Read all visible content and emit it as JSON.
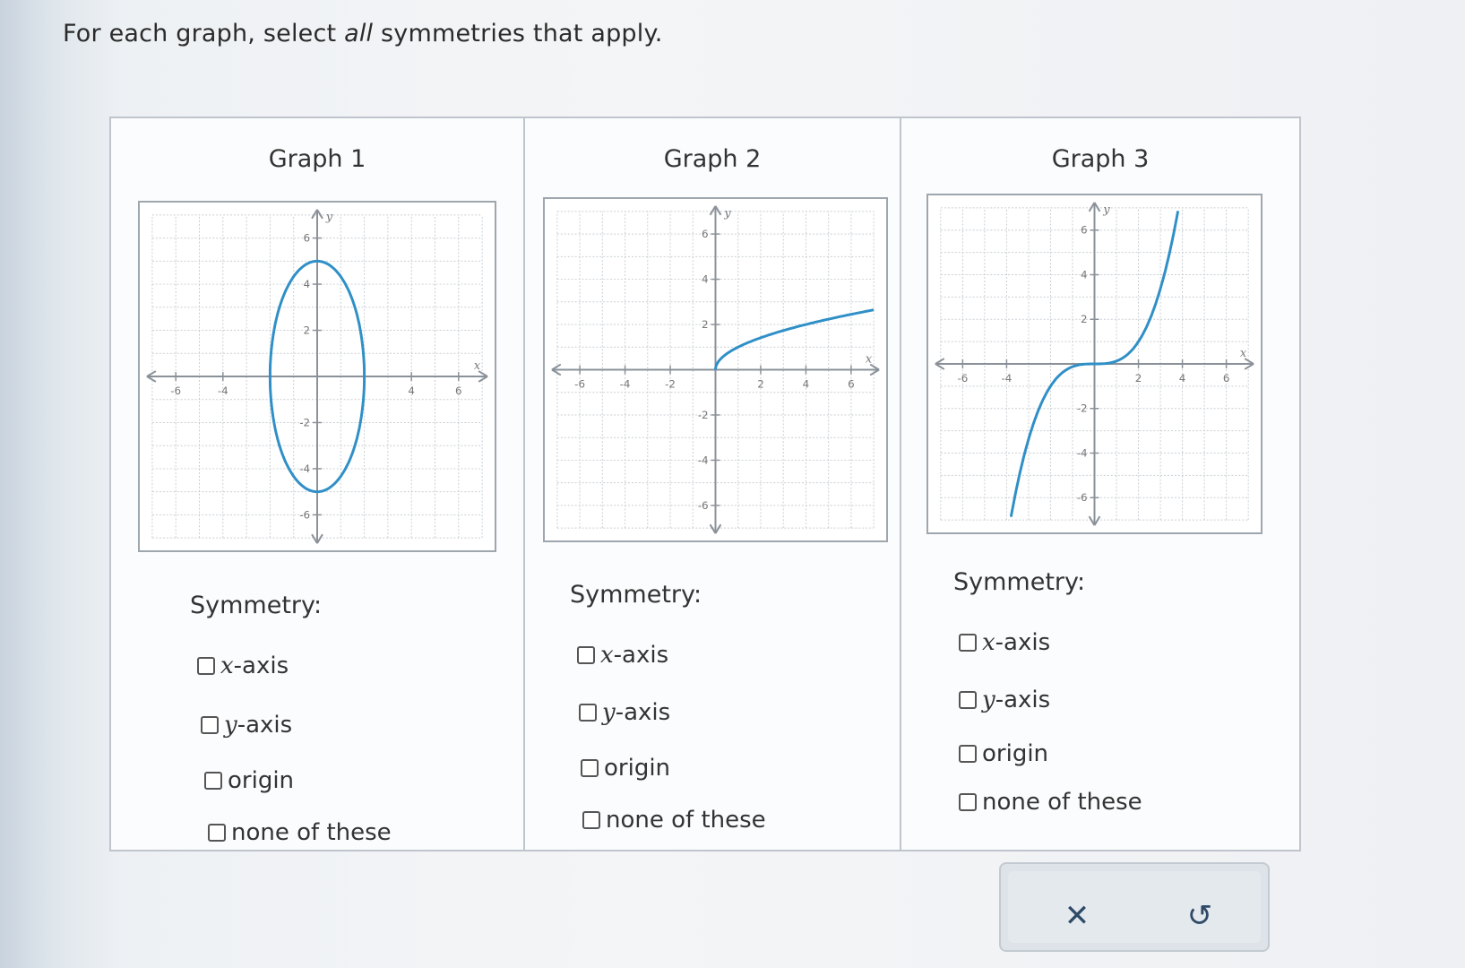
{
  "prompt": {
    "before": "For each graph, select ",
    "emphasis": "all",
    "after": " symmetries that apply."
  },
  "graphs": [
    {
      "title": "Graph 1",
      "chart_data": {
        "type": "line",
        "title": "Graph 1",
        "xlabel": "x",
        "ylabel": "y",
        "xlim": [
          -7,
          7
        ],
        "ylim": [
          -7,
          7
        ],
        "xticks": [
          -6,
          -4,
          4,
          6
        ],
        "yticks": [
          6,
          4,
          2,
          -2,
          -4,
          -6
        ],
        "grid": true,
        "curve": "ellipse centered at origin, x-radius 2, y-radius 5"
      }
    },
    {
      "title": "Graph 2",
      "chart_data": {
        "type": "line",
        "title": "Graph 2",
        "xlabel": "x",
        "ylabel": "y",
        "xlim": [
          -7,
          7
        ],
        "ylim": [
          -7,
          7
        ],
        "xticks": [
          -6,
          -4,
          -2,
          2,
          4,
          6
        ],
        "yticks": [
          6,
          4,
          2,
          -2,
          -4,
          -6
        ],
        "grid": true,
        "curve": "square-root curve from (0,0) rising to about (7,2.6)"
      }
    },
    {
      "title": "Graph 3",
      "chart_data": {
        "type": "line",
        "title": "Graph 3",
        "xlabel": "x",
        "ylabel": "y",
        "xlim": [
          -7,
          7
        ],
        "ylim": [
          -7,
          7
        ],
        "xticks": [
          -6,
          -4,
          2,
          4,
          6
        ],
        "yticks": [
          6,
          4,
          2,
          -2,
          -4,
          -6
        ],
        "grid": true,
        "curve": "cubic y = x^3/8 through origin"
      }
    }
  ],
  "symmetry_label": "Symmetry:",
  "options": {
    "x_axis_var": "x",
    "x_axis_suffix": "-axis",
    "y_axis_var": "y",
    "y_axis_suffix": "-axis",
    "origin": "origin",
    "none": "none of these"
  },
  "actions": {
    "clear_glyph": "✕",
    "undo_glyph": "↺"
  },
  "colors": {
    "curve": "#2f8fc7",
    "axis": "#8a9198",
    "grid": "#c9ced3"
  }
}
